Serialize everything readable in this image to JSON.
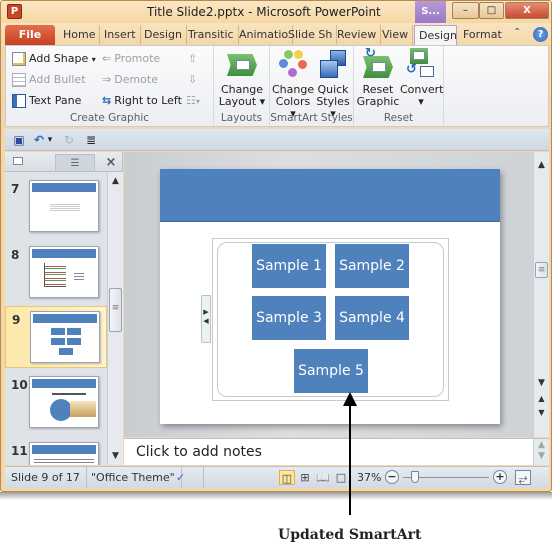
{
  "window": {
    "app_icon_letter": "P",
    "title": "Title Slide2.pptx  -  Microsoft PowerPoint",
    "context_tab_label": "S...",
    "minimize_glyph": "–",
    "maximize_glyph": "□",
    "close_glyph": "X"
  },
  "tabs": [
    {
      "label": "File"
    },
    {
      "label": "Home"
    },
    {
      "label": "Insert"
    },
    {
      "label": "Design"
    },
    {
      "label": "Transitic"
    },
    {
      "label": "Animatio"
    },
    {
      "label": "Slide Sh"
    },
    {
      "label": "Review"
    },
    {
      "label": "View"
    },
    {
      "label": "Design",
      "active": true
    },
    {
      "label": "Format"
    }
  ],
  "ribbon": {
    "create_graphic": {
      "label": "Create Graphic",
      "add_shape": "Add Shape",
      "add_bullet": "Add Bullet",
      "text_pane": "Text Pane",
      "promote": "Promote",
      "demote": "Demote",
      "right_to_left": "Right to Left"
    },
    "layouts": {
      "label": "Layouts",
      "change_layout_1": "Change",
      "change_layout_2": "Layout ▾"
    },
    "smartart_styles": {
      "label": "SmartArt Styles",
      "change_colors_1": "Change",
      "change_colors_2": "Colors ▾",
      "quick_styles_1": "Quick",
      "quick_styles_2": "Styles ▾"
    },
    "reset": {
      "label": "Reset",
      "reset_graphic_1": "Reset",
      "reset_graphic_2": "Graphic",
      "convert_1": "Convert",
      "convert_2": "▾"
    }
  },
  "qat": {
    "save_glyph": "▣",
    "undo_glyph": "↶",
    "dropdown_glyph": "▾",
    "redo_glyph": "↻",
    "customize_glyph": "≣"
  },
  "slide_pane": {
    "close_glyph": "×",
    "thumbnails": [
      {
        "number": "7"
      },
      {
        "number": "8"
      },
      {
        "number": "9",
        "selected": true
      },
      {
        "number": "10"
      },
      {
        "number": "11"
      }
    ]
  },
  "slide": {
    "smartart_boxes": [
      {
        "label": "Sample 1"
      },
      {
        "label": "Sample 2"
      },
      {
        "label": "Sample 3"
      },
      {
        "label": "Sample 4"
      },
      {
        "label": "Sample 5"
      }
    ]
  },
  "notes": {
    "placeholder": "Click to add notes"
  },
  "statusbar": {
    "slide_info": "Slide 9 of 17",
    "theme": "\"Office Theme\"",
    "zoom_level": "37%",
    "zoom_fraction": 0.37
  },
  "annotation": {
    "caption": "Updated SmartArt"
  },
  "colors": {
    "accent_blue": "#4f81bd",
    "file_tab": "#c7401f",
    "context_tab": "#9a78c6"
  }
}
